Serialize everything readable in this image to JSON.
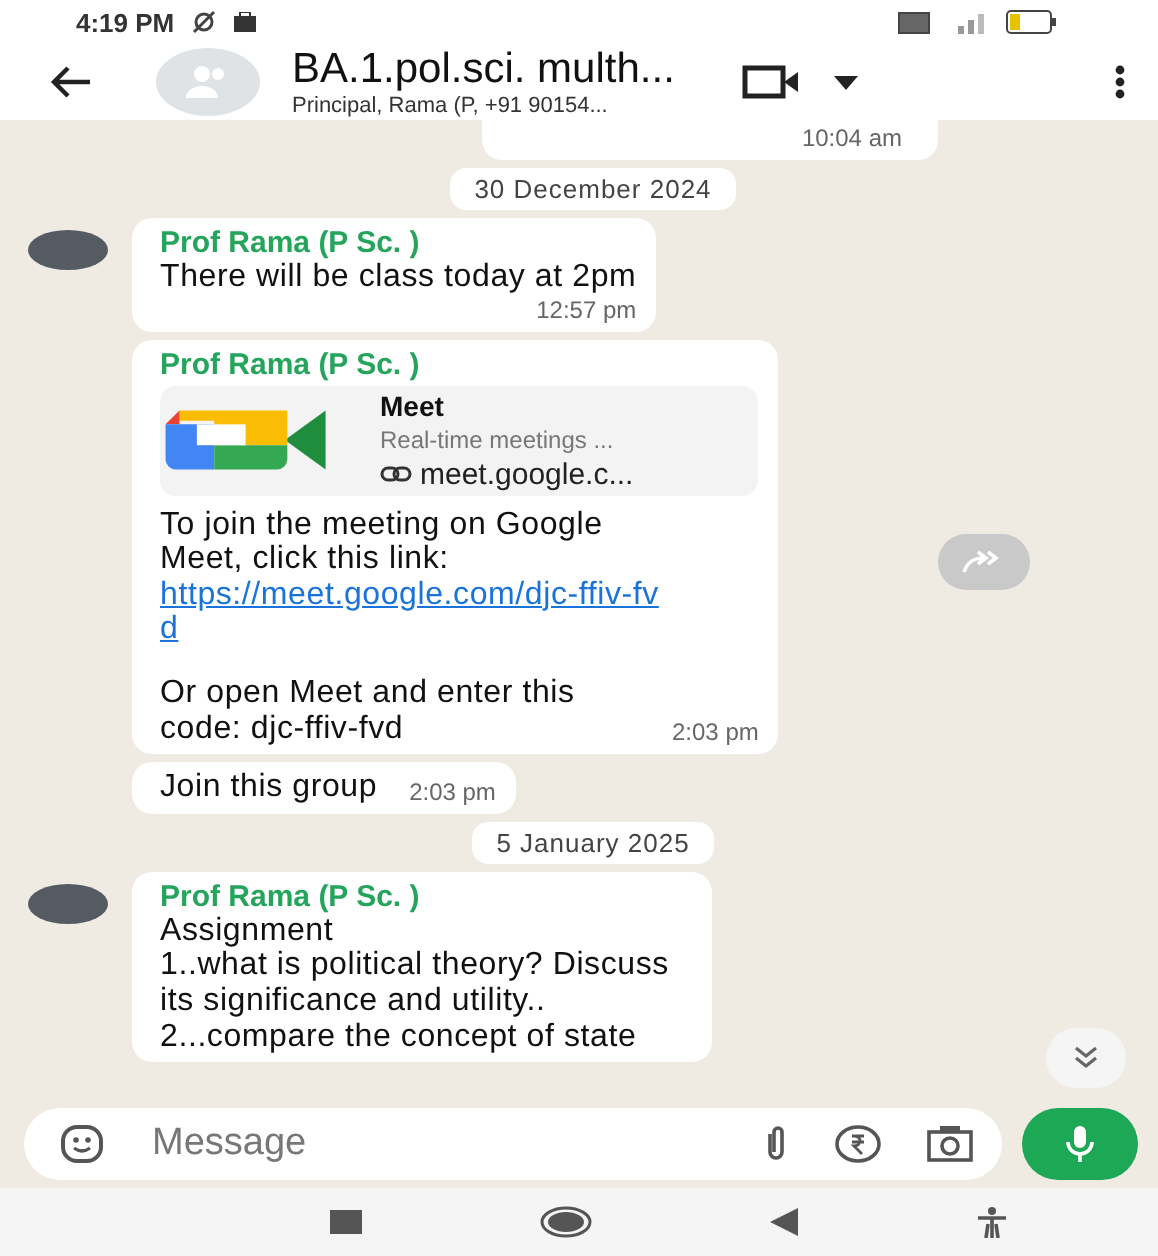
{
  "status_bar": {
    "time": "4:19 PM"
  },
  "header": {
    "title": "BA.1.pol.sci. multh...",
    "subtitle": "Principal, Rama (P, +91 90154..."
  },
  "messages": [
    {
      "kind": "time_only",
      "time": "10:04 am"
    },
    {
      "kind": "date",
      "text": "30 December 2024"
    },
    {
      "kind": "text",
      "avatar": true,
      "sender": "Prof Rama (P Sc. )",
      "text": "There will be class today at 2pm",
      "time": "12:57 pm"
    },
    {
      "kind": "link_preview",
      "avatar": false,
      "sender": "Prof Rama (P Sc. )",
      "preview_title": "Meet",
      "preview_description": "Real-time meetings ...",
      "preview_domain": "meet.google.c...",
      "text": "To join the meeting on Google Meet, click this link:",
      "link": "https://meet.google.com/djc-ffiv-fvd",
      "text_after": "Or open Meet and enter this code: djc-ffiv-fvd",
      "time": "2:03 pm"
    },
    {
      "kind": "text",
      "avatar": false,
      "text": "Join this group",
      "time": "2:03 pm"
    },
    {
      "kind": "date",
      "text": "5 January 2025"
    },
    {
      "kind": "text",
      "avatar": true,
      "sender": "Prof Rama (P Sc. )",
      "text": "Assignment\n1..what is political theory? Discuss its significance and utility..\n2...compare the concept of  state"
    }
  ],
  "composer": {
    "placeholder": "Message"
  }
}
